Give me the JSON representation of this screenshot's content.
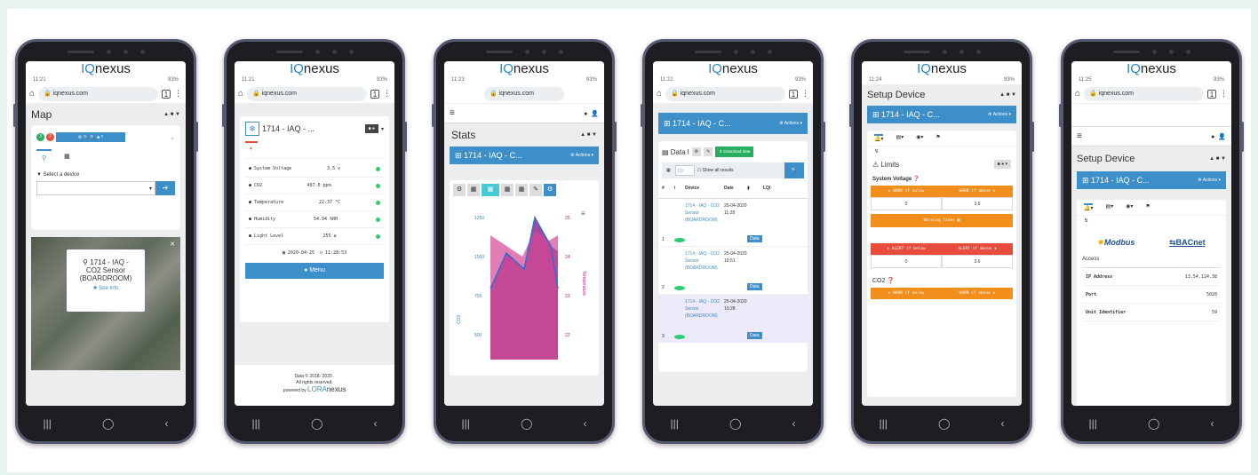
{
  "brand": {
    "iq": "IQ",
    "rest": "nexus",
    "accent": "#3d8fc9"
  },
  "phones": [
    {
      "time": "11:21",
      "battery": "93%",
      "url": "iqnexus.com",
      "page_title": "Map",
      "badges": [
        "3",
        "2"
      ],
      "select_label": "Select a device",
      "popup_line1": "1714 - IAQ -",
      "popup_line2": "CO2 Sensor",
      "popup_line3": "(BOARDROOM)",
      "popup_link": "See Info"
    },
    {
      "time": "11:21",
      "battery": "93%",
      "url": "iqnexus.com",
      "device": "1714 - IAQ - ...",
      "rows": [
        {
          "label": "System Voltage",
          "value": "3.5 v"
        },
        {
          "label": "CO2",
          "value": "497.0 ppm"
        },
        {
          "label": "Temperature",
          "value": "22.37 °C"
        },
        {
          "label": "Humidity",
          "value": "54.94 %RH"
        },
        {
          "label": "Light Level",
          "value": "255 a"
        }
      ],
      "date": "2020-04-25",
      "clock": "11:28:53",
      "menu": "Menu",
      "footer1": "Data © 2018- 2020 .",
      "footer2": "All rights reserved.",
      "footer3": "powered by",
      "footer_brand1": "LORA",
      "footer_brand2": "nexus"
    },
    {
      "time": "11:23",
      "battery": "93%",
      "url": "iqnexus.com",
      "page_title": "Stats",
      "device": "1714 - IAQ - C...",
      "actions": "Actions",
      "y_left_ticks": [
        "1250",
        "1000",
        "750",
        "500"
      ],
      "y_right_ticks": [
        "25",
        "24",
        "23",
        "22"
      ],
      "y_left_label": "CO2",
      "y_right_label": "Temperature"
    },
    {
      "time": "11:22",
      "battery": "93%",
      "url": "iqnexus.com",
      "device": "1714 - IAQ - C...",
      "actions": "Actions",
      "data_title": "Data l",
      "download": "Download data",
      "search_placeholder": "Ch",
      "show_all": "Show all results",
      "columns": [
        "#",
        "i",
        "Device",
        "Date",
        "",
        "LQI"
      ],
      "rows": [
        {
          "n": "1",
          "device": "1714 - IAQ - CO2 Sensor (BOARDROOM)",
          "date": "25-04-2020 11:28"
        },
        {
          "n": "2",
          "device": "1714 - IAQ - CO2 Sensor (BOARDROOM)",
          "date": "25-04-2020 10:51"
        },
        {
          "n": "3",
          "device": "1714 - IAQ - CO2 Sensor (BOARDROOM)",
          "date": "25-04-2020 10:28"
        }
      ],
      "data_btn": "Data"
    },
    {
      "time": "11:24",
      "battery": "93%",
      "title": "Setup Device",
      "device": "1714 - IAQ - C...",
      "actions": "Actions",
      "limits": "Limits",
      "system_voltage": "System Voltage",
      "warn_below": "WARN if below",
      "warn_above": "WARN if above",
      "sv_below": "0",
      "sv_above": "3.6",
      "warning_times": "Warning Times",
      "alert_below": "ALERT if below",
      "alert_above": "ALERT if above",
      "al_below": "0",
      "al_above": "3.6",
      "co2": "CO2"
    },
    {
      "time": "11:25",
      "battery": "93%",
      "url": "iqnexus.com",
      "title": "Setup Device",
      "device": "1714 - IAQ - C...",
      "actions": "Actions",
      "modbus": "Modbus",
      "bacnet": "BACnet",
      "access": "Access",
      "rows": [
        {
          "label": "IP Address",
          "value": "13.54.124.38"
        },
        {
          "label": "Port",
          "value": "5020"
        },
        {
          "label": "Unit Identifier",
          "value": "59"
        }
      ]
    }
  ]
}
